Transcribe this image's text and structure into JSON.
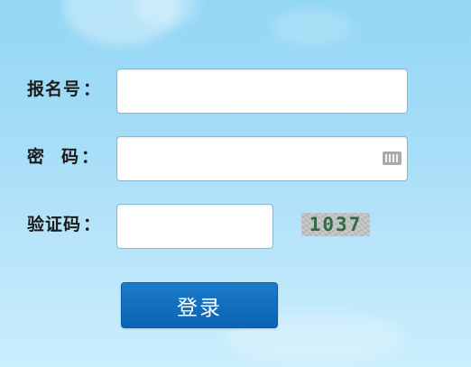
{
  "form": {
    "username_label": "报名号",
    "password_label_part1": "密",
    "password_label_part2": "码",
    "captcha_label": "验证码",
    "colon": "：",
    "username_value": "",
    "password_value": "",
    "captcha_value": "",
    "captcha_image_text": "1037",
    "password_icon": "keyboard-icon",
    "login_button": "登录"
  },
  "colors": {
    "login_button": "#0a63b3",
    "captcha_text": "#2f6b46",
    "background_top": "#93d7f5",
    "background_bottom": "#cbeefc"
  }
}
